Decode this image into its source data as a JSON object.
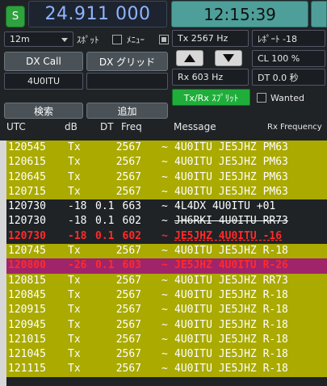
{
  "header": {
    "s_label": "S",
    "frequency": "24.911 000",
    "clock": "12:15:39"
  },
  "controls": {
    "band": "12m",
    "spot_label": "ｽﾎﾟｯﾄ",
    "menu_label": "ﾒﾆｭｰ",
    "tx_label": "Tx  2567  Hz",
    "report_label": "ﾚﾎﾟｰﾄ -18",
    "dx_call_btn": "DX Call",
    "dx_grid_btn": "DX グリッド",
    "dx_call_value": "4U0ITU",
    "cl_label": "CL  100 %",
    "rx_label": "Rx  603  Hz",
    "dt_label": "DT 0.0 秒",
    "split_btn": "Tx/Rx ｽﾌﾟﾘｯﾄ",
    "wanted_label": "Wanted",
    "search_btn": "検索",
    "add_btn": "追加"
  },
  "columns": {
    "utc": "UTC",
    "db": "dB",
    "dt": "DT",
    "freq": "Freq",
    "message": "Message",
    "rx_freq": "Rx  Frequency"
  },
  "colors": {
    "tx_row": "#aaaa00",
    "rx_row": "#1f2326",
    "alert_row": "#a0246a",
    "alert_text": "#ff2a2a"
  },
  "rows": [
    {
      "utc": "120545",
      "db": "Tx",
      "dt": "",
      "freq": "2567",
      "sep": "~",
      "msg": "4U0ITU JE5JHZ PM63",
      "type": "tx"
    },
    {
      "utc": "120615",
      "db": "Tx",
      "dt": "",
      "freq": "2567",
      "sep": "~",
      "msg": "4U0ITU JE5JHZ PM63",
      "type": "tx"
    },
    {
      "utc": "120645",
      "db": "Tx",
      "dt": "",
      "freq": "2567",
      "sep": "~",
      "msg": "4U0ITU JE5JHZ PM63",
      "type": "tx"
    },
    {
      "utc": "120715",
      "db": "Tx",
      "dt": "",
      "freq": "2567",
      "sep": "~",
      "msg": "4U0ITU JE5JHZ PM63",
      "type": "tx"
    },
    {
      "utc": "120730",
      "db": "-18",
      "dt": "0.1",
      "freq": "663",
      "sep": "~",
      "msg": "4L4DX 4U0ITU +01",
      "type": "rx"
    },
    {
      "utc": "120730",
      "db": "-18",
      "dt": "0.1",
      "freq": "602",
      "sep": "~",
      "msg": "JH6RKI 4U0ITU RR73",
      "type": "rx-strike"
    },
    {
      "utc": "120730",
      "db": "-18",
      "dt": "0.1",
      "freq": "602",
      "sep": "~",
      "msg": "JE5JHZ 4U0ITU -16",
      "type": "alert-dark"
    },
    {
      "utc": "120745",
      "db": "Tx",
      "dt": "",
      "freq": "2567",
      "sep": "~",
      "msg": "4U0ITU JE5JHZ R-18",
      "type": "tx"
    },
    {
      "utc": "120800",
      "db": "-26",
      "dt": "0.1",
      "freq": "603",
      "sep": "~",
      "msg": "JE5JHZ 4U0ITU R-26",
      "type": "alert"
    },
    {
      "utc": "120815",
      "db": "Tx",
      "dt": "",
      "freq": "2567",
      "sep": "~",
      "msg": "4U0ITU JE5JHZ RR73",
      "type": "tx"
    },
    {
      "utc": "120845",
      "db": "Tx",
      "dt": "",
      "freq": "2567",
      "sep": "~",
      "msg": "4U0ITU JE5JHZ R-18",
      "type": "tx"
    },
    {
      "utc": "120915",
      "db": "Tx",
      "dt": "",
      "freq": "2567",
      "sep": "~",
      "msg": "4U0ITU JE5JHZ R-18",
      "type": "tx"
    },
    {
      "utc": "120945",
      "db": "Tx",
      "dt": "",
      "freq": "2567",
      "sep": "~",
      "msg": "4U0ITU JE5JHZ R-18",
      "type": "tx"
    },
    {
      "utc": "121015",
      "db": "Tx",
      "dt": "",
      "freq": "2567",
      "sep": "~",
      "msg": "4U0ITU JE5JHZ R-18",
      "type": "tx"
    },
    {
      "utc": "121045",
      "db": "Tx",
      "dt": "",
      "freq": "2567",
      "sep": "~",
      "msg": "4U0ITU JE5JHZ R-18",
      "type": "tx"
    },
    {
      "utc": "121115",
      "db": "Tx",
      "dt": "",
      "freq": "2567",
      "sep": "~",
      "msg": "4U0ITU JE5JHZ R-18",
      "type": "tx"
    }
  ]
}
